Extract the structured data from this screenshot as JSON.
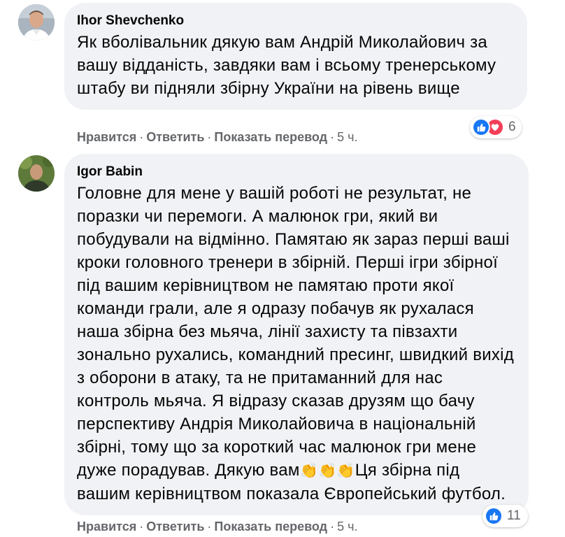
{
  "comments": [
    {
      "author": "Ihor Shevchenko",
      "text": "Як вболівальник дякую вам Андрій Миколайович за вашу відданість, завдяки вам і всьому тренерському штабу ви підняли збірну України на рівень вище",
      "actions": {
        "like": "Нравится",
        "reply": "Ответить",
        "translate": "Показать перевод",
        "time": "5 ч."
      },
      "reactions": {
        "icons": [
          "like-icon",
          "love-icon"
        ],
        "count": "6"
      }
    },
    {
      "author": "Igor Babin",
      "text_before": "Головне для мене у вашій роботі не результат, не поразки чи перемоги. А малюнок гри, який ви побудували на відмінно. Памятаю як зараз перші ваші кроки головного тренери в збірній. Перші ігри збірної під вашим керівництвом не памятаю проти якої команди грали, але я одразу побачув як рухалася наша збірна без мьяча, лінії захисту та півзахти зонально рухались, командний пресинг, швидкий вихід з оборони в атаку, та не притаманний для нас контроль мьяча. Я відразу сказав друзям що бачу перспективу Андрія Миколайовича в національній збірні, тому що за короткий час малюнок гри мене дуже порадував. Дякую вам",
      "emoji": "👏👏👏",
      "text_after": "Ця збірна під вашим керівництвом показала Європейський футбол.",
      "actions": {
        "like": "Нравится",
        "reply": "Ответить",
        "translate": "Показать перевод",
        "time": "5 ч."
      },
      "reactions": {
        "icons": [
          "like-icon"
        ],
        "count": "11"
      }
    }
  ],
  "colors": {
    "like": "#1877f2",
    "love": "#f33e58",
    "bubble": "#f0f2f5",
    "meta": "#65676b"
  }
}
